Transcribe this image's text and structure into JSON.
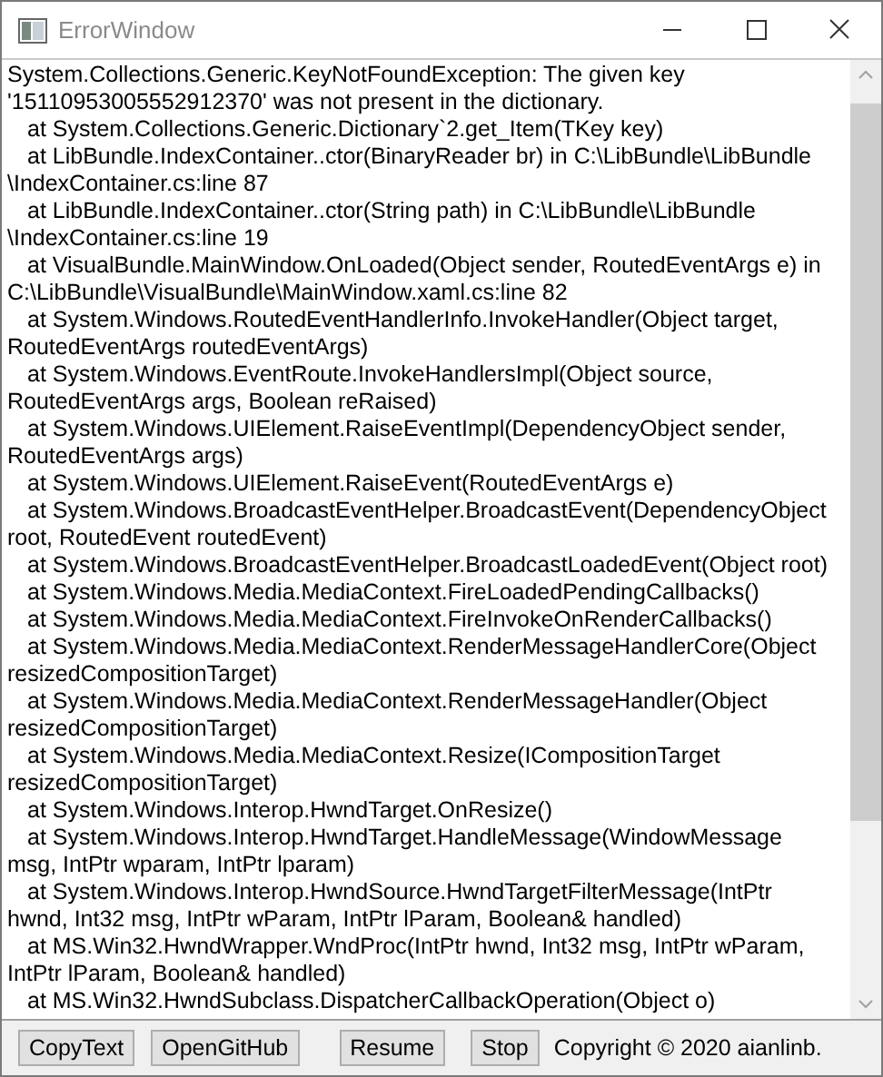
{
  "window": {
    "title": "ErrorWindow"
  },
  "trace_lines": [
    {
      "kind": "wrap",
      "text": "System.Collections.Generic.KeyNotFoundException: The given key"
    },
    {
      "kind": "wrap",
      "text": "'15110953005552912370' was not present in the dictionary."
    },
    {
      "kind": "frame",
      "text": "at System.Collections.Generic.Dictionary`2.get_Item(TKey key)"
    },
    {
      "kind": "frame",
      "text": "at LibBundle.IndexContainer..ctor(BinaryReader br) in C:\\LibBundle\\LibBundle"
    },
    {
      "kind": "wrap",
      "text": "\\IndexContainer.cs:line 87"
    },
    {
      "kind": "frame",
      "text": "at LibBundle.IndexContainer..ctor(String path) in C:\\LibBundle\\LibBundle"
    },
    {
      "kind": "wrap",
      "text": "\\IndexContainer.cs:line 19"
    },
    {
      "kind": "frame",
      "text": "at VisualBundle.MainWindow.OnLoaded(Object sender, RoutedEventArgs e) in"
    },
    {
      "kind": "wrap",
      "text": "C:\\LibBundle\\VisualBundle\\MainWindow.xaml.cs:line 82"
    },
    {
      "kind": "frame",
      "text": "at System.Windows.RoutedEventHandlerInfo.InvokeHandler(Object target,"
    },
    {
      "kind": "wrap",
      "text": "RoutedEventArgs routedEventArgs)"
    },
    {
      "kind": "frame",
      "text": "at System.Windows.EventRoute.InvokeHandlersImpl(Object source,"
    },
    {
      "kind": "wrap",
      "text": "RoutedEventArgs args, Boolean reRaised)"
    },
    {
      "kind": "frame",
      "text": "at System.Windows.UIElement.RaiseEventImpl(DependencyObject sender,"
    },
    {
      "kind": "wrap",
      "text": "RoutedEventArgs args)"
    },
    {
      "kind": "frame",
      "text": "at System.Windows.UIElement.RaiseEvent(RoutedEventArgs e)"
    },
    {
      "kind": "frame",
      "text": "at System.Windows.BroadcastEventHelper.BroadcastEvent(DependencyObject"
    },
    {
      "kind": "wrap",
      "text": "root, RoutedEvent routedEvent)"
    },
    {
      "kind": "frame",
      "text": "at System.Windows.BroadcastEventHelper.BroadcastLoadedEvent(Object root)"
    },
    {
      "kind": "frame",
      "text": "at System.Windows.Media.MediaContext.FireLoadedPendingCallbacks()"
    },
    {
      "kind": "frame",
      "text": "at System.Windows.Media.MediaContext.FireInvokeOnRenderCallbacks()"
    },
    {
      "kind": "frame",
      "text": "at System.Windows.Media.MediaContext.RenderMessageHandlerCore(Object"
    },
    {
      "kind": "wrap",
      "text": "resizedCompositionTarget)"
    },
    {
      "kind": "frame",
      "text": "at System.Windows.Media.MediaContext.RenderMessageHandler(Object"
    },
    {
      "kind": "wrap",
      "text": "resizedCompositionTarget)"
    },
    {
      "kind": "frame",
      "text": "at System.Windows.Media.MediaContext.Resize(ICompositionTarget"
    },
    {
      "kind": "wrap",
      "text": "resizedCompositionTarget)"
    },
    {
      "kind": "frame",
      "text": "at System.Windows.Interop.HwndTarget.OnResize()"
    },
    {
      "kind": "frame",
      "text": "at System.Windows.Interop.HwndTarget.HandleMessage(WindowMessage"
    },
    {
      "kind": "wrap",
      "text": "msg, IntPtr wparam, IntPtr lparam)"
    },
    {
      "kind": "frame",
      "text": "at System.Windows.Interop.HwndSource.HwndTargetFilterMessage(IntPtr"
    },
    {
      "kind": "wrap",
      "text": "hwnd, Int32 msg, IntPtr wParam, IntPtr lParam, Boolean& handled)"
    },
    {
      "kind": "frame",
      "text": "at MS.Win32.HwndWrapper.WndProc(IntPtr hwnd, Int32 msg, IntPtr wParam,"
    },
    {
      "kind": "wrap",
      "text": "IntPtr lParam, Boolean& handled)"
    },
    {
      "kind": "frame",
      "text": "at MS.Win32.HwndSubclass.DispatcherCallbackOperation(Object o)"
    }
  ],
  "buttons": [
    {
      "label": "CopyText"
    },
    {
      "label": "OpenGitHub"
    },
    {
      "label": "Resume"
    },
    {
      "label": "Stop"
    }
  ],
  "copyright": "Copyright © 2020 aianlinb."
}
